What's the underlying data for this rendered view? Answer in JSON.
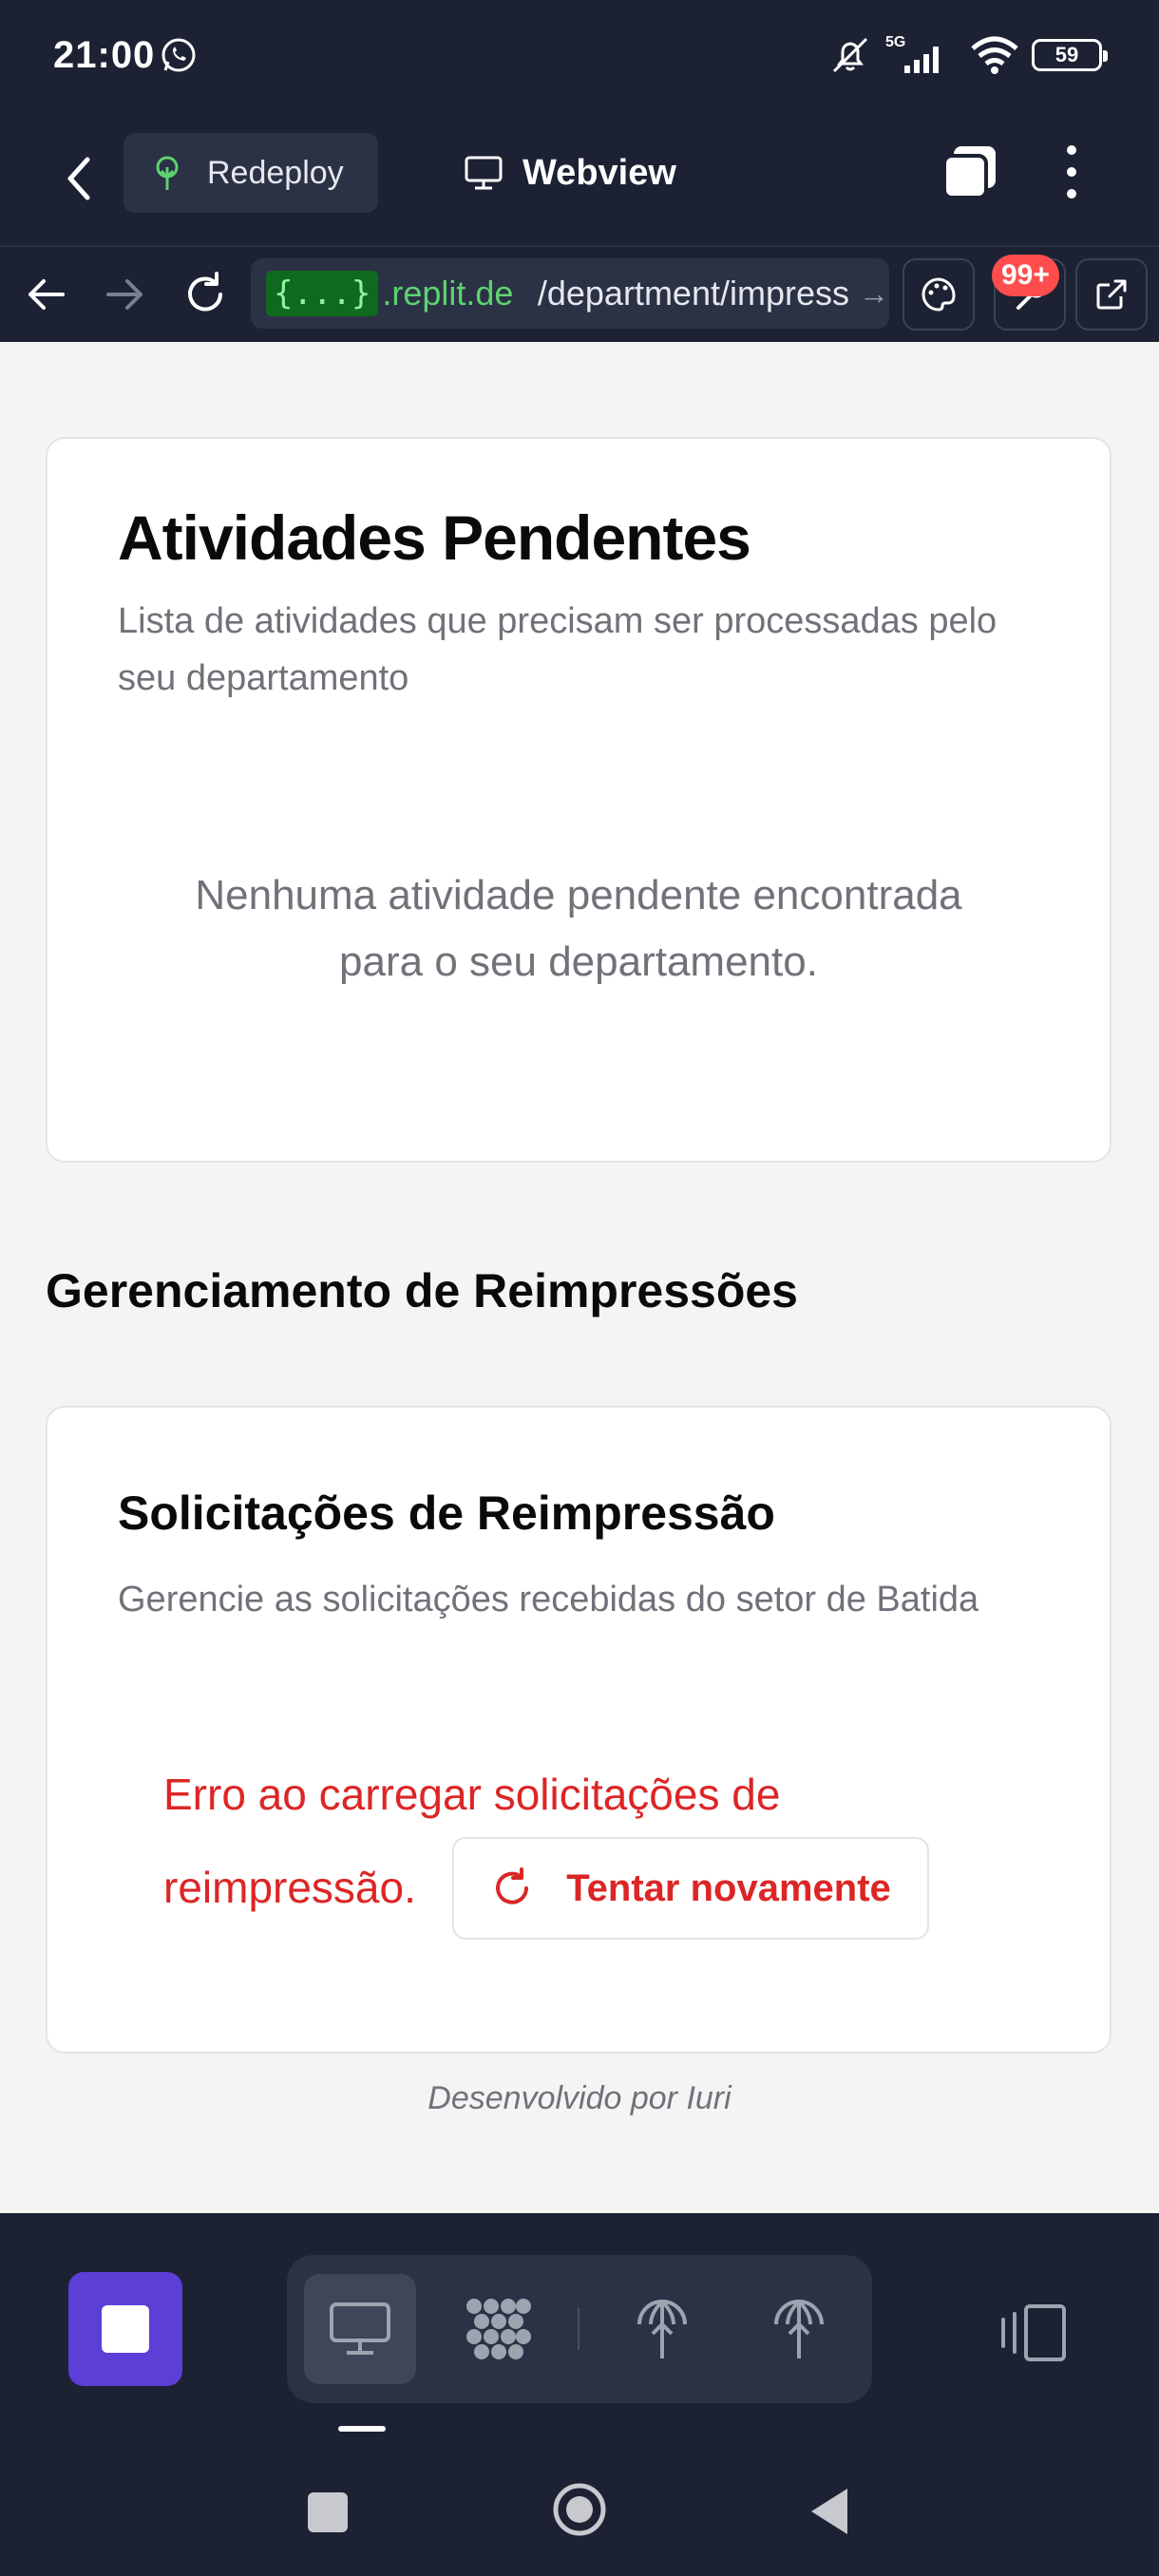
{
  "status_bar": {
    "time": "21:00",
    "network": "5G",
    "battery": "59"
  },
  "app_header": {
    "redeploy_label": "Redeploy",
    "webview_label": "Webview"
  },
  "browser": {
    "url_braces": "{...}",
    "url_host": ".replit.de",
    "url_path": "/department/impress",
    "url_arrow": "→",
    "badge": "99+"
  },
  "pending_card": {
    "title": "Atividades Pendentes",
    "description": "Lista de atividades que precisam ser processadas pelo seu departamento",
    "empty_line1": "Nenhuma atividade pendente encontrada",
    "empty_line2": "para o seu departamento."
  },
  "reprint_section": {
    "heading": "Gerenciamento de Reimpressões",
    "card_title": "Solicitações de Reimpressão",
    "card_description": "Gerencie as solicitações recebidas do setor de Batida",
    "error_line1": "Erro ao carregar solicitações de",
    "error_line2": "reimpressão.",
    "retry_label": "Tentar novamente"
  },
  "footer": {
    "credit": "Desenvolvido por Iuri"
  },
  "colors": {
    "background_dark": "#1c2233",
    "accent_purple": "#5b3fd6",
    "error_red": "#dc2626",
    "url_green": "#5ed36e"
  }
}
